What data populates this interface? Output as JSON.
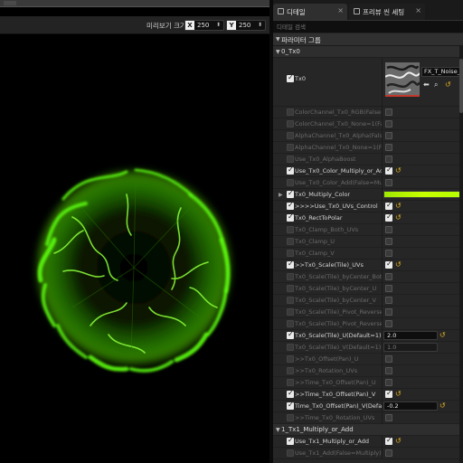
{
  "viewport": {
    "preview_size_label": "미리보기 크기",
    "size_x": {
      "axis": "X",
      "value": "250"
    },
    "size_y": {
      "axis": "Y",
      "value": "250"
    }
  },
  "tabs": [
    {
      "label": "디테일",
      "close": "×"
    },
    {
      "label": "프리뷰 씬 세팅",
      "close": "×"
    }
  ],
  "search": {
    "placeholder": "디테일 검색"
  },
  "group": {
    "label": "파라미터 그룹"
  },
  "texture": {
    "asset_name": "FX_T_Noise_Tile"
  },
  "rows": [
    {
      "kind": "cat",
      "label": "0_Tx0"
    },
    {
      "kind": "texture",
      "label": "Tx0",
      "checked": true
    },
    {
      "kind": "bool",
      "label": "ColorChannel_Tx0_RGB(False=stH",
      "checked": false,
      "dim": true,
      "value": false,
      "reset": false
    },
    {
      "kind": "bool",
      "label": "ColorChannel_Tx0_None=1(False=",
      "checked": false,
      "dim": true,
      "value": false,
      "reset": false
    },
    {
      "kind": "bool",
      "label": "AlphaChannel_Tx0_Alpha(False=cf",
      "checked": false,
      "dim": true,
      "value": false,
      "reset": false
    },
    {
      "kind": "bool",
      "label": "AlphaChannel_Tx0_None=1(False=",
      "checked": false,
      "dim": true,
      "value": false,
      "reset": false
    },
    {
      "kind": "bool",
      "label": "Use_Tx0_AlphaBoost",
      "checked": false,
      "dim": true,
      "value": false,
      "reset": false
    },
    {
      "kind": "bool",
      "label": "Use_Tx0_Color_Multiply_or_Add",
      "checked": true,
      "dim": false,
      "value": true,
      "reset": true
    },
    {
      "kind": "bool",
      "label": "Use_Tx0_Color_Add(False=Multipl",
      "checked": false,
      "dim": true,
      "value": false,
      "reset": false
    },
    {
      "kind": "color",
      "label": "Tx0_Multiply_Color",
      "checked": true,
      "dim": false
    },
    {
      "kind": "bool",
      "label": ">>>>Use_Tx0_UVs_Control",
      "checked": true,
      "dim": false,
      "value": true,
      "reset": true
    },
    {
      "kind": "bool",
      "label": "Tx0_RectToPolar",
      "checked": true,
      "dim": false,
      "value": true,
      "reset": true
    },
    {
      "kind": "bool",
      "label": "Tx0_Clamp_Both_UVs",
      "checked": false,
      "dim": true,
      "value": false,
      "reset": false
    },
    {
      "kind": "bool",
      "label": "Tx0_Clamp_U",
      "checked": false,
      "dim": true,
      "value": false,
      "reset": false
    },
    {
      "kind": "bool",
      "label": "Tx0_Clamp_V",
      "checked": false,
      "dim": true,
      "value": false,
      "reset": false
    },
    {
      "kind": "bool",
      "label": ">>Tx0_Scale(Tile)_UVs",
      "checked": true,
      "dim": false,
      "value": true,
      "reset": true
    },
    {
      "kind": "bool",
      "label": "Tx0_Scale(Tile)_byCenter_Both_U",
      "checked": false,
      "dim": true,
      "value": false,
      "reset": false
    },
    {
      "kind": "bool",
      "label": "Tx0_Scale(Tile)_byCenter_U",
      "checked": false,
      "dim": true,
      "value": false,
      "reset": false
    },
    {
      "kind": "bool",
      "label": "Tx0_Scale(Tile)_byCenter_V",
      "checked": false,
      "dim": true,
      "value": false,
      "reset": false
    },
    {
      "kind": "bool",
      "label": "Tx0_Scale(Tile)_Pivot_Reverse_U",
      "checked": false,
      "dim": true,
      "value": false,
      "reset": false
    },
    {
      "kind": "bool",
      "label": "Tx0_Scale(Tile)_Pivot_Reverse_V",
      "checked": false,
      "dim": true,
      "value": false,
      "reset": false
    },
    {
      "kind": "num",
      "label": "Tx0_Scale(Tile)_U(Default=1)",
      "checked": true,
      "dim": false,
      "value": "2.0",
      "reset": true
    },
    {
      "kind": "num",
      "label": "Tx0_Scale(Tile)_V(Default=1)",
      "checked": false,
      "dim": true,
      "value": "1.0",
      "reset": false
    },
    {
      "kind": "bool",
      "label": ">>Tx0_Offset(Pan)_U",
      "checked": false,
      "dim": true,
      "value": false,
      "reset": false
    },
    {
      "kind": "bool",
      "label": ">>Tx0_Rotation_UVs",
      "checked": false,
      "dim": true,
      "value": false,
      "reset": false
    },
    {
      "kind": "bool",
      "label": ">>Time_Tx0_Offset(Pan)_U",
      "checked": false,
      "dim": true,
      "value": false,
      "reset": false
    },
    {
      "kind": "bool",
      "label": ">>Time_Tx0_Offset(Pan)_V",
      "checked": true,
      "dim": false,
      "value": true,
      "reset": true
    },
    {
      "kind": "num",
      "label": "Time_Tx0_Offset(Pan)_V(Default=",
      "checked": true,
      "dim": false,
      "value": "-0.2",
      "reset": true
    },
    {
      "kind": "bool",
      "label": ">>Time_Tx0_Rotation_UVs",
      "checked": false,
      "dim": true,
      "value": false,
      "reset": false
    },
    {
      "kind": "cat",
      "label": "1_Tx1_Multiply_or_Add"
    },
    {
      "kind": "bool",
      "label": "Use_Tx1_Multiply_or_Add",
      "checked": true,
      "dim": false,
      "value": true,
      "reset": true
    },
    {
      "kind": "bool",
      "label": "Use_Tx1_Add(False=Multiply)",
      "checked": false,
      "dim": true,
      "value": false,
      "reset": false
    }
  ],
  "colors": {
    "accent_green": "#7cff1a",
    "reset_yellow": "#e0b020",
    "color_param": "#b5ff00"
  }
}
